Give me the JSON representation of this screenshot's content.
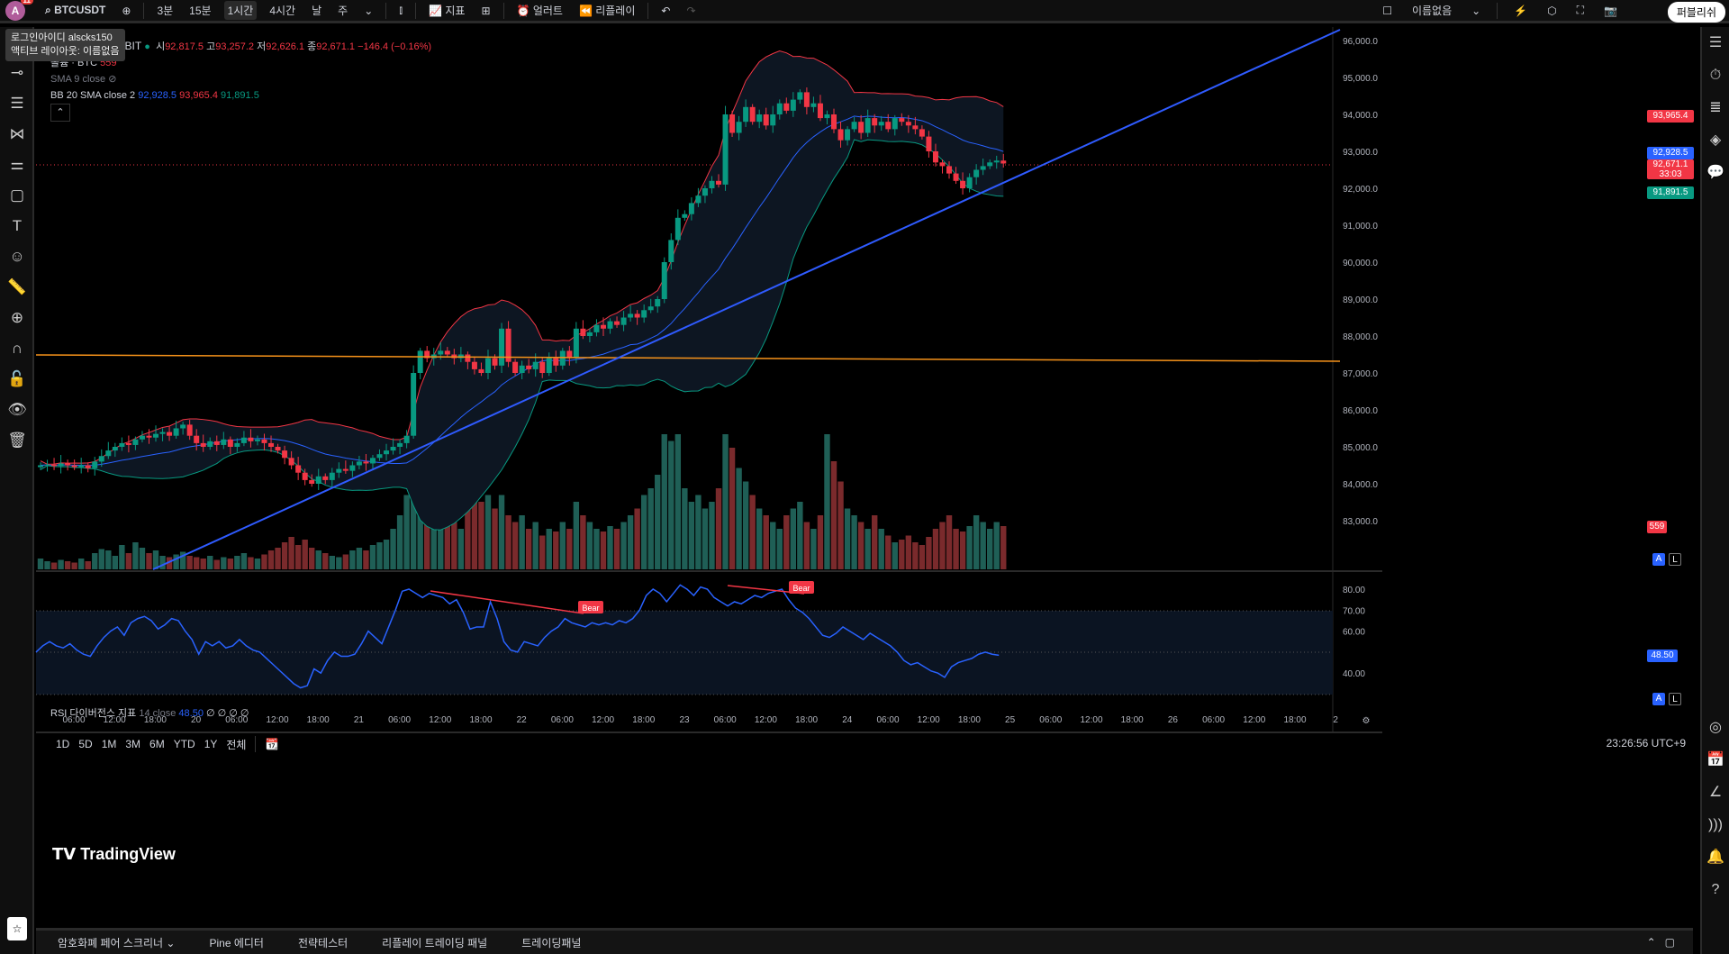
{
  "topbar": {
    "avatar": "A",
    "notif": "11",
    "symbol": "BTCUSDT",
    "intervals": [
      "3분",
      "15분",
      "1시간",
      "4시간",
      "날",
      "주"
    ],
    "active_interval": "1시간",
    "indicators": "지표",
    "alert": "얼러트",
    "replay": "리플레이",
    "layout_name": "이름없음",
    "publish": "퍼블리쉬"
  },
  "tooltip": {
    "line1": "로그인아이디 alscks150",
    "line2": "액티브 레이아웃: 이름없음"
  },
  "legend": {
    "title": "OT · 1시간 · BYBIT",
    "o_label": "시",
    "o": "92,817.5",
    "h_label": "고",
    "h": "93,257.2",
    "l_label": "저",
    "l": "92,626.1",
    "c_label": "종",
    "c": "92,671.1",
    "chg": "−146.4 (−0.16%)",
    "vol": "볼륨 · BTC",
    "vol_val": "559",
    "sma": "SMA 9 close",
    "bb": "BB 20 SMA close 2",
    "bb_mid": "92,928.5",
    "bb_up": "93,965.4",
    "bb_low": "91,891.5"
  },
  "rsi_legend": {
    "name": "RSI 다이버전스 지표",
    "params": "14 close",
    "value": "48.50",
    "extras": "∅ ∅ ∅ ∅"
  },
  "price_axis": [
    "96,000.0",
    "95,000.0",
    "94,000.0",
    "93,000.0",
    "92,000.0",
    "91,000.0",
    "90,000.0",
    "89,000.0",
    "88,000.0",
    "87,000.0",
    "86,000.0",
    "85,000.0",
    "84,000.0",
    "83,000.0"
  ],
  "price_tags": {
    "upper": "93,965.4",
    "mid": "92,928.5",
    "last": "92,671.1",
    "countdown": "33:03",
    "lower": "91,891.5",
    "vol": "559"
  },
  "rsi_axis": [
    "80.00",
    "70.00",
    "60.00",
    "40.00"
  ],
  "rsi_tag": "48.50",
  "bear_label": "Bear",
  "time_axis": [
    "06:00",
    "12:00",
    "18:00",
    "20",
    "06:00",
    "12:00",
    "18:00",
    "21",
    "06:00",
    "12:00",
    "18:00",
    "22",
    "06:00",
    "12:00",
    "18:00",
    "23",
    "06:00",
    "12:00",
    "18:00",
    "24",
    "06:00",
    "12:00",
    "18:00",
    "25",
    "06:00",
    "12:00",
    "18:00",
    "26",
    "06:00",
    "12:00",
    "18:00",
    "2"
  ],
  "ranges": [
    "1D",
    "5D",
    "1M",
    "3M",
    "6M",
    "YTD",
    "1Y",
    "전체"
  ],
  "clock": "23:26:56 UTC+9",
  "bottom_tabs": [
    "암호화폐 페어 스크리너",
    "Pine 에디터",
    "전략테스터",
    "리플레이 트레이딩 패널",
    "트레이딩패널"
  ],
  "logo": "TradingView",
  "scale_btns": [
    "A",
    "L"
  ],
  "colors": {
    "up": "#089981",
    "down": "#f23645",
    "bb_upper": "#f23645",
    "bb_mid": "#2962ff",
    "bb_lower": "#089981",
    "rsi": "#2962ff",
    "trend": "#2f5bff",
    "hline": "#f7931a"
  },
  "chart_data": {
    "type": "candlestick",
    "closes": [
      84500,
      84520,
      84480,
      84550,
      84500,
      84450,
      84500,
      84420,
      84600,
      84750,
      84900,
      85000,
      85100,
      85050,
      85200,
      85300,
      85250,
      85350,
      85400,
      85300,
      85500,
      85600,
      85300,
      85100,
      85000,
      85150,
      85050,
      85200,
      85000,
      85100,
      85250,
      85150,
      85200,
      85100,
      85000,
      84900,
      84700,
      84500,
      84300,
      84100,
      84000,
      84200,
      84100,
      84300,
      84400,
      84350,
      84500,
      84600,
      84550,
      84700,
      84800,
      84900,
      85000,
      85100,
      85300,
      87000,
      87600,
      87400,
      87500,
      87600,
      87500,
      87400,
      87500,
      87300,
      87100,
      87000,
      87400,
      87200,
      88200,
      87300,
      87000,
      87200,
      87100,
      87300,
      87000,
      87400,
      87200,
      87600,
      87400,
      88200,
      88000,
      88100,
      88300,
      88200,
      88400,
      88300,
      88500,
      88600,
      88500,
      88700,
      88800,
      89000,
      90000,
      90600,
      91200,
      91300,
      91600,
      91800,
      92000,
      92200,
      92100,
      94000,
      93500,
      93800,
      94200,
      93800,
      94000,
      93700,
      94000,
      94300,
      94100,
      94400,
      94600,
      94200,
      94300,
      93900,
      94000,
      93600,
      93300,
      93600,
      93800,
      93500,
      93900,
      93700,
      93800,
      93600,
      93900,
      93800,
      93700,
      93600,
      93400,
      93000,
      92700,
      92600,
      92400,
      92200,
      92000,
      92300,
      92500,
      92600,
      92700,
      92750,
      92671
    ],
    "volumes": [
      8,
      6,
      5,
      7,
      6,
      5,
      8,
      6,
      12,
      15,
      14,
      10,
      18,
      12,
      20,
      16,
      12,
      14,
      10,
      9,
      11,
      13,
      10,
      9,
      8,
      10,
      7,
      9,
      8,
      10,
      12,
      9,
      8,
      11,
      14,
      16,
      20,
      24,
      18,
      22,
      16,
      14,
      12,
      10,
      9,
      11,
      14,
      16,
      14,
      18,
      20,
      22,
      30,
      40,
      55,
      95,
      85,
      60,
      50,
      45,
      40,
      35,
      30,
      60,
      75,
      50,
      55,
      45,
      55,
      40,
      35,
      40,
      30,
      35,
      25,
      30,
      28,
      35,
      30,
      50,
      40,
      35,
      30,
      28,
      32,
      30,
      35,
      40,
      45,
      55,
      60,
      70,
      100,
      95,
      100,
      60,
      50,
      55,
      45,
      50,
      60,
      100,
      90,
      75,
      65,
      55,
      45,
      40,
      35,
      30,
      40,
      45,
      50,
      35,
      30,
      40,
      100,
      80,
      65,
      45,
      40,
      35,
      30,
      40,
      30,
      25,
      20,
      22,
      25,
      20,
      18,
      24,
      30,
      35,
      40,
      30,
      28,
      32,
      40,
      35,
      30,
      35,
      32
    ],
    "rsi": [
      50,
      53,
      55,
      53,
      52,
      54,
      51,
      49,
      48,
      53,
      57,
      60,
      62,
      58,
      64,
      66,
      67,
      65,
      61,
      63,
      66,
      65,
      60,
      56,
      49,
      55,
      53,
      55,
      52,
      53,
      56,
      53,
      51,
      50,
      47,
      44,
      41,
      38,
      35,
      33,
      34,
      42,
      40,
      46,
      50,
      48,
      48,
      49,
      54,
      60,
      57,
      54,
      62,
      70,
      79,
      80,
      78,
      76,
      78,
      77,
      76,
      73,
      75,
      69,
      61,
      62,
      62,
      74,
      66,
      55,
      51,
      50,
      55,
      54,
      53,
      57,
      60,
      62,
      66,
      64,
      63,
      62,
      64,
      63,
      64,
      63,
      65,
      64,
      66,
      70,
      77,
      80,
      78,
      74,
      78,
      82,
      80,
      77,
      81,
      80,
      76,
      74,
      72,
      74,
      73,
      75,
      77,
      76,
      78,
      79,
      80,
      75,
      71,
      69,
      66,
      62,
      58,
      57,
      59,
      62,
      60,
      58,
      56,
      59,
      57,
      55,
      53,
      50,
      46,
      44,
      45,
      43,
      41,
      40,
      38,
      43,
      45,
      46,
      47,
      49,
      50,
      49,
      48.5
    ],
    "ylim": [
      83000,
      96000
    ],
    "rsi_ylim": [
      30,
      85
    ]
  }
}
